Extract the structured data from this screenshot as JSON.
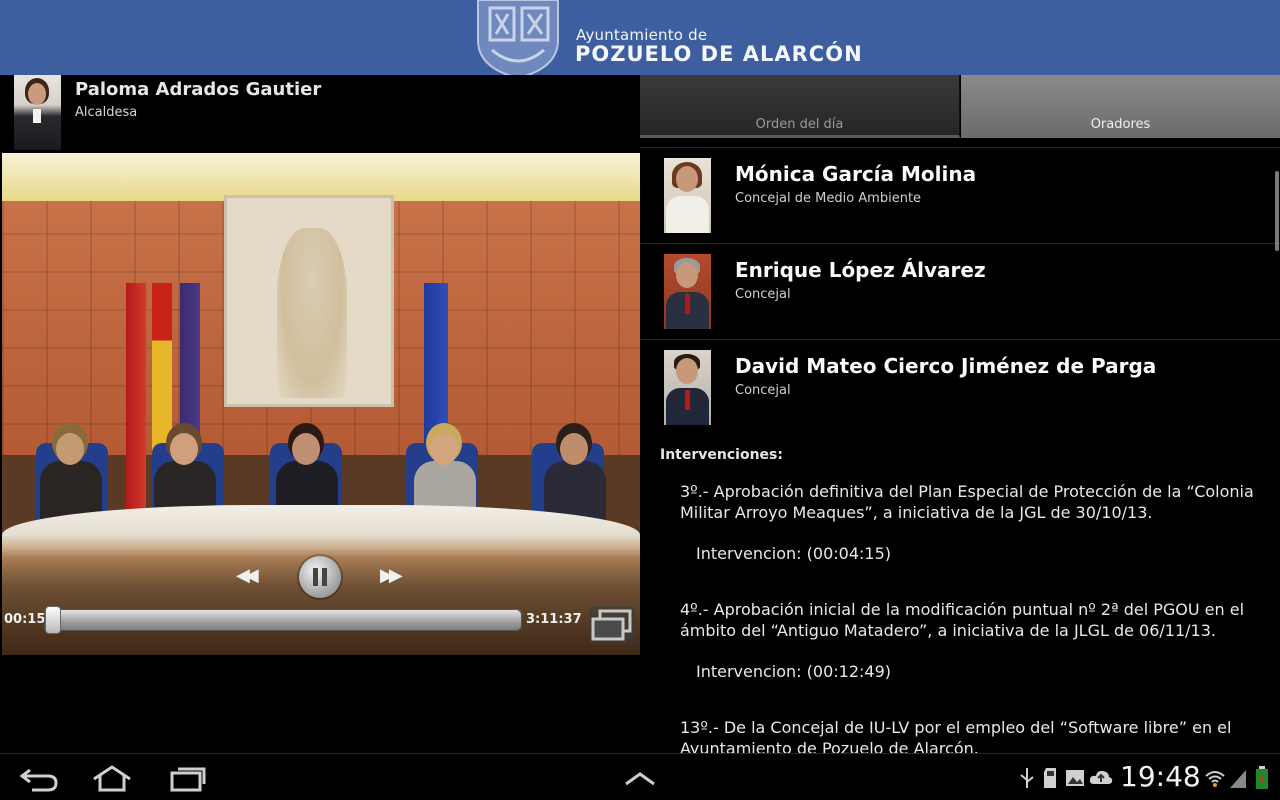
{
  "header": {
    "brand_small": "Ayuntamiento de",
    "brand_big": "POZUELO DE ALARCÓN"
  },
  "current_speaker": {
    "name": "Paloma Adrados Gautier",
    "role": "Alcaldesa"
  },
  "player": {
    "current_time": "00:15",
    "total_time": "3:11:37",
    "progress_fraction": 0.0013,
    "state": "playing"
  },
  "tabs": [
    {
      "label": "Orden del día",
      "active": false
    },
    {
      "label": "Oradores",
      "active": true
    }
  ],
  "speakers": [
    {
      "name": "Mónica García Molina",
      "role": "Concejal de Medio Ambiente"
    },
    {
      "name": "Enrique López Álvarez",
      "role": "Concejal"
    },
    {
      "name": "David Mateo Cierco Jiménez de Parga",
      "role": "Concejal"
    }
  ],
  "interventions": {
    "title": "Intervenciones:",
    "items": [
      {
        "text": "3º.- Aprobación definitiva del Plan Especial de Protección de la “Colonia Militar Arroyo Meaques”, a iniciativa de la JGL de 30/10/13.",
        "link": "Intervencion: (00:04:15)"
      },
      {
        "text": "4º.- Aprobación inicial de la modificación puntual nº 2ª del PGOU en el ámbito del “Antiguo Matadero”, a iniciativa de la JLGL de 06/11/13.",
        "link": "Intervencion: (00:12:49)"
      },
      {
        "text": "13º.- De la Concejal de IU-LV por el empleo del “Software libre” en el Ayuntamiento de Pozuelo de Alarcón.",
        "link": ""
      }
    ]
  },
  "statusbar": {
    "clock": "19:48"
  },
  "colors": {
    "header_bg": "#3d5fa0",
    "tab_active": "#7a7a7a",
    "tab_inactive": "#2e2e2e"
  }
}
